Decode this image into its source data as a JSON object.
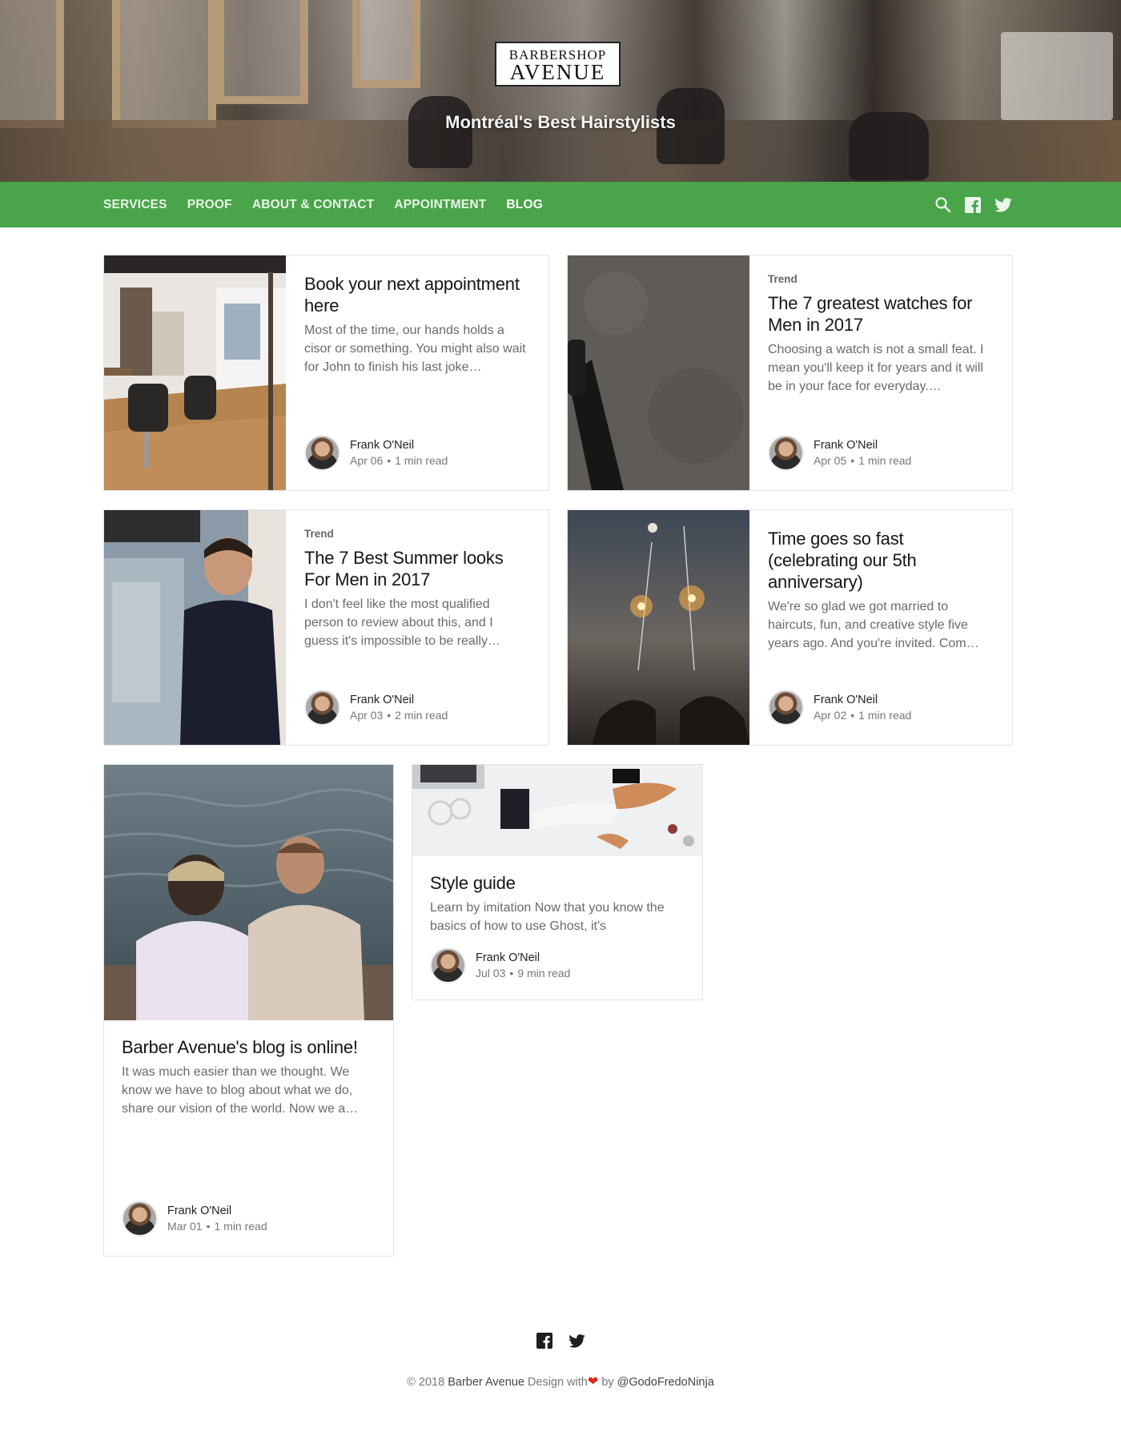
{
  "brand": {
    "logo_line1": "BARBERSHOP",
    "logo_line2": "AVENUE",
    "tagline": "Montréal's Best Hairstylists"
  },
  "nav": {
    "links": [
      "SERVICES",
      "PROOF",
      "ABOUT & CONTACT",
      "APPOINTMENT",
      "BLOG"
    ],
    "active": "BLOG",
    "icons": [
      "search-icon",
      "facebook-icon",
      "twitter-icon"
    ]
  },
  "posts": [
    {
      "tag": "",
      "title": "Book your next appointment here",
      "excerpt": "Most of the time, our hands holds a cisor or something. You might also wait for John to finish his last joke…",
      "author": "Frank O'Neil",
      "date": "Apr 06",
      "read": "1 min read"
    },
    {
      "tag": "Trend",
      "title": "The 7 greatest watches for Men in 2017",
      "excerpt": "Choosing a watch is not a small feat. I mean you'll keep it for years and it will be in your face for everyday.…",
      "author": "Frank O'Neil",
      "date": "Apr 05",
      "read": "1 min read"
    },
    {
      "tag": "Trend",
      "title": "The 7 Best Summer looks For Men in 2017",
      "excerpt": "I don't feel like the most qualified person to review about this, and I guess it's impossible to be really…",
      "author": "Frank O'Neil",
      "date": "Apr 03",
      "read": "2 min read"
    },
    {
      "tag": "",
      "title": "Time goes so fast (celebrating our 5th anniversary)",
      "excerpt": "We're so glad we got married to haircuts, fun, and creative style five years ago. And you're invited. Com…",
      "author": "Frank O'Neil",
      "date": "Apr 02",
      "read": "1 min read"
    },
    {
      "tag": "",
      "title": "Barber Avenue's blog is online!",
      "excerpt": "It was much easier than we thought. We know we have to blog about what we do, share our vision of the world. Now we a…",
      "author": "Frank O'Neil",
      "date": "Mar 01",
      "read": "1 min read"
    },
    {
      "tag": "",
      "title": "Style guide",
      "excerpt": "Learn by imitation Now that you know the basics of how to use Ghost, it's",
      "author": "Frank O'Neil",
      "date": "Jul 03",
      "read": "9 min read"
    }
  ],
  "footer": {
    "copyright": "© 2018",
    "brand": "Barber Avenue",
    "design_with": "Design with",
    "by": "by",
    "handle": "@GodoFredoNinja",
    "icons": [
      "facebook-icon",
      "twitter-icon"
    ]
  },
  "colors": {
    "nav_green": "#4aa44a",
    "heart_red": "#e0281e"
  }
}
